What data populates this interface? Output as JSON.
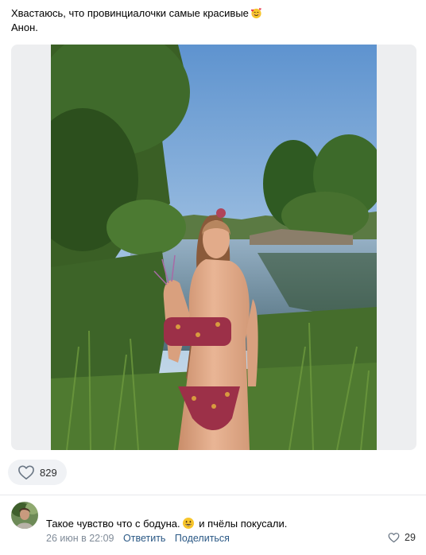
{
  "post": {
    "text_line1": "Хвастаюсь, что провинциалочки самые красивые",
    "text_line2": "Анон.",
    "emoji": "smiling-face-with-hearts"
  },
  "media": {
    "kind": "photo",
    "background_color": "#edeef0"
  },
  "reactions": {
    "likes_count": "829",
    "icon": "heart-outline-icon"
  },
  "comment": {
    "text_before": "Такое чувство что с бодуна.",
    "emoji": "grinning-face",
    "text_after": " и пчёлы покусали.",
    "date": "26 июн в 22:09",
    "reply_label": "Ответить",
    "share_label": "Поделиться",
    "likes_count": "29"
  },
  "colors": {
    "link": "#2a5885",
    "meta": "#818c99",
    "pill_bg": "#f0f2f5",
    "divider": "#e7e8ec"
  }
}
